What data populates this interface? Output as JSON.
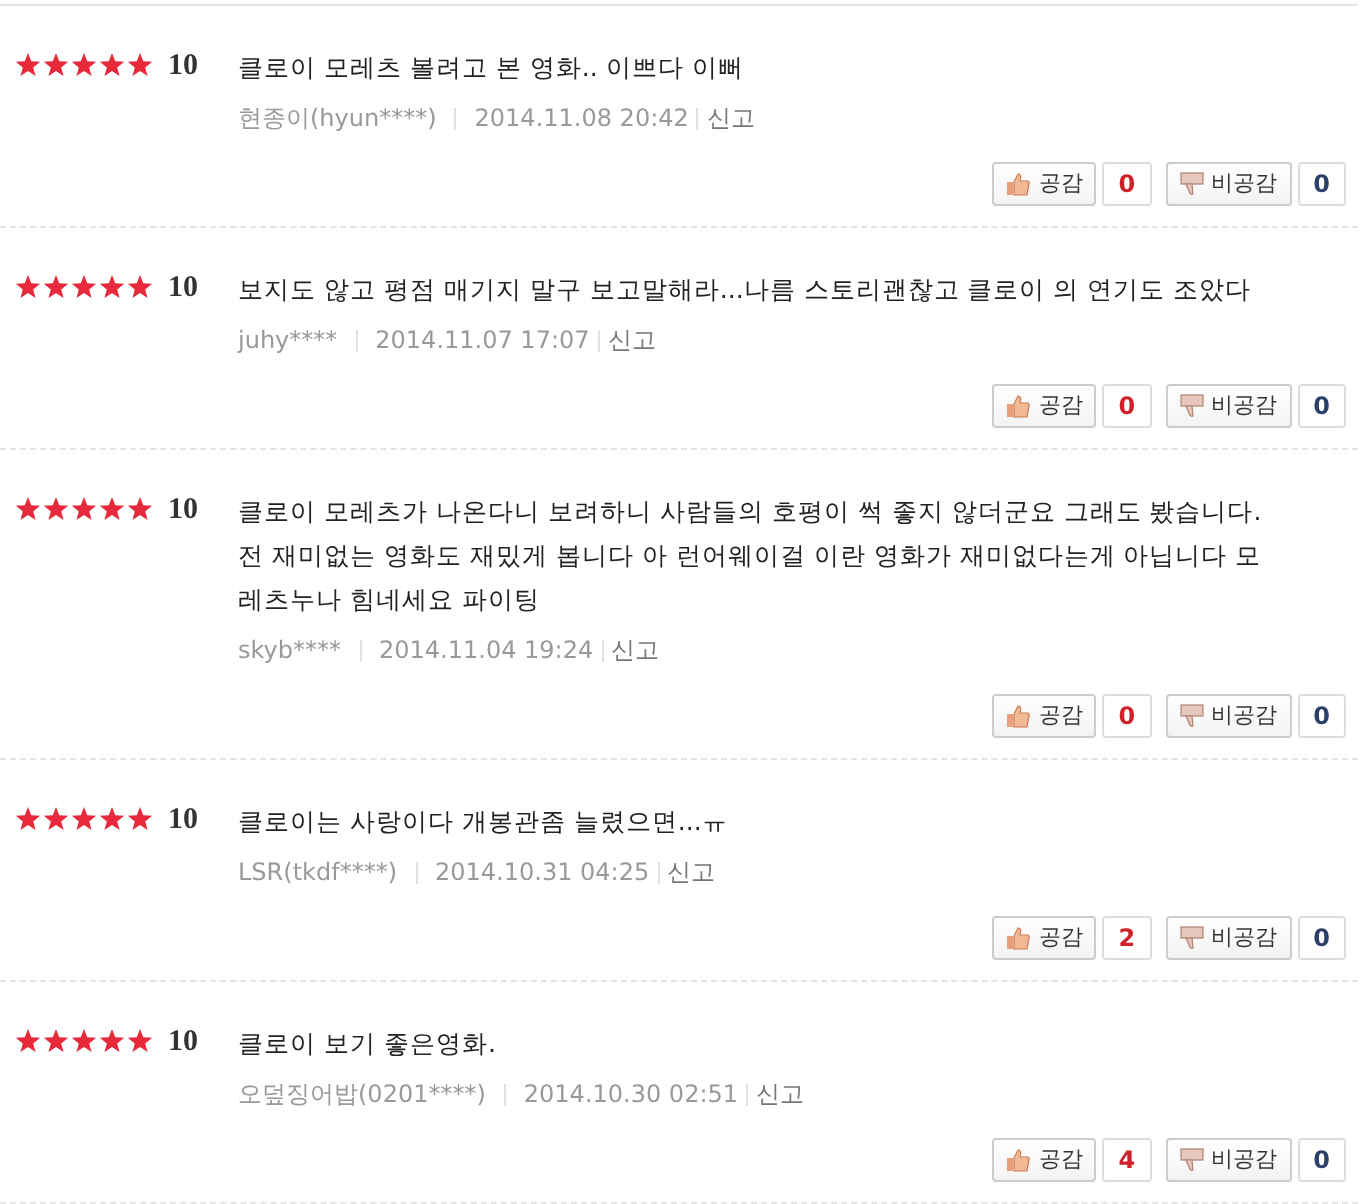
{
  "reviews": [
    {
      "stars": 5,
      "score": "10",
      "text": "클로이 모레츠 볼려고 본 영화.. 이쁘다 이뻐",
      "author": "현종이(hyun****)",
      "date": "2014.11.08 20:42",
      "report": "신고",
      "like_label": "공감",
      "likes": "0",
      "dislike_label": "비공감",
      "dislikes": "0"
    },
    {
      "stars": 5,
      "score": "10",
      "text": "보지도 않고 평점 매기지 말구 보고말해라...나름 스토리괜찮고 클로이 의 연기도 조았다",
      "author": "juhy****",
      "date": "2014.11.07 17:07",
      "report": "신고",
      "like_label": "공감",
      "likes": "0",
      "dislike_label": "비공감",
      "dislikes": "0"
    },
    {
      "stars": 5,
      "score": "10",
      "text": "클로이 모레츠가 나온다니 보려하니 사람들의 호평이 썩 좋지 않더군요 그래도 봤습니다. 전 재미없는 영화도 재밌게 봅니다 아 런어웨이걸 이란 영화가 재미없다는게 아닙니다 모레츠누나 힘네세요 파이팅",
      "author": "skyb****",
      "date": "2014.11.04 19:24",
      "report": "신고",
      "like_label": "공감",
      "likes": "0",
      "dislike_label": "비공감",
      "dislikes": "0"
    },
    {
      "stars": 5,
      "score": "10",
      "text": "클로이는 사랑이다 개봉관좀 늘렸으면...ㅠ",
      "author": "LSR(tkdf****)",
      "date": "2014.10.31 04:25",
      "report": "신고",
      "like_label": "공감",
      "likes": "2",
      "dislike_label": "비공감",
      "dislikes": "0"
    },
    {
      "stars": 5,
      "score": "10",
      "text": "클로이 보기 좋은영화.",
      "author": "오덮징어밥(0201****)",
      "date": "2014.10.30 02:51",
      "report": "신고",
      "like_label": "공감",
      "likes": "4",
      "dislike_label": "비공감",
      "dislikes": "0"
    }
  ]
}
